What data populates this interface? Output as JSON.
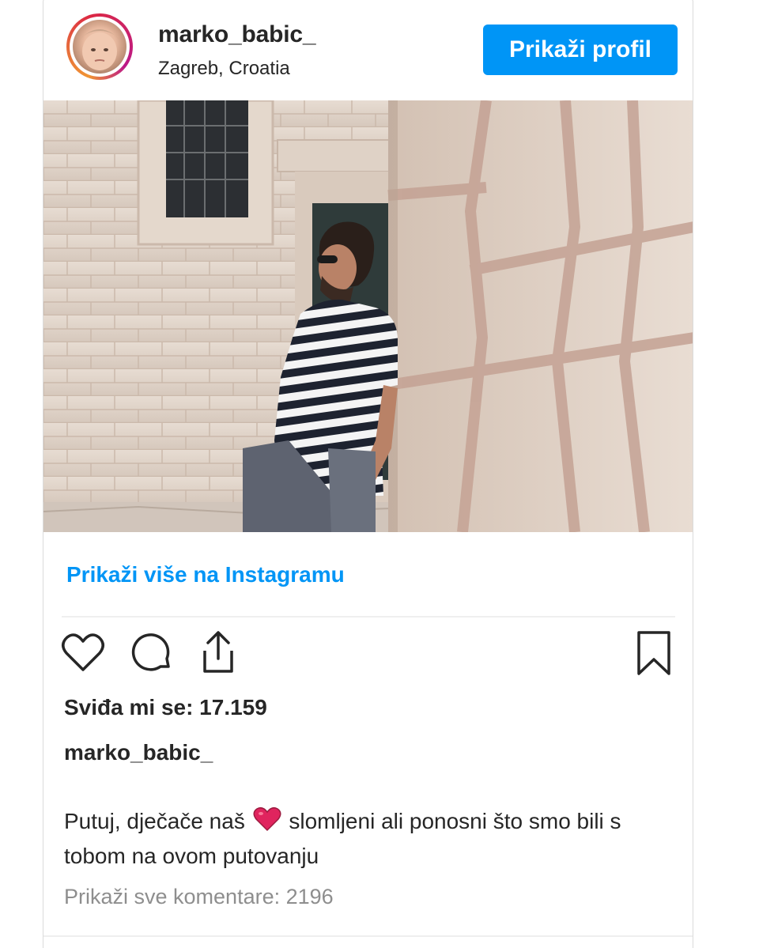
{
  "post": {
    "username": "marko_babic_",
    "location": "Zagreb, Croatia",
    "view_profile_label": "Prikaži profil",
    "view_more_label": "Prikaži više na Instagramu",
    "likes_text": "Sviđa mi se: 17.159",
    "caption_author": "marko_babic_",
    "caption_part1": "Putuj, dječače naš",
    "caption_part2": "slomljeni ali ponosni što smo bili s tobom na ovom putovanju",
    "comments_text": "Prikaži sve komentare: 2196"
  },
  "icons": {
    "like": "heart-outline-icon",
    "comment": "comment-bubble-icon",
    "share": "share-upload-icon",
    "save": "bookmark-icon",
    "caption_emoji": "red-heart-emoji"
  },
  "colors": {
    "accent": "#0095f6",
    "text": "#262626",
    "muted": "#8e8e8e",
    "border": "#dbdbdb",
    "emoji_heart": "#e0245e"
  }
}
